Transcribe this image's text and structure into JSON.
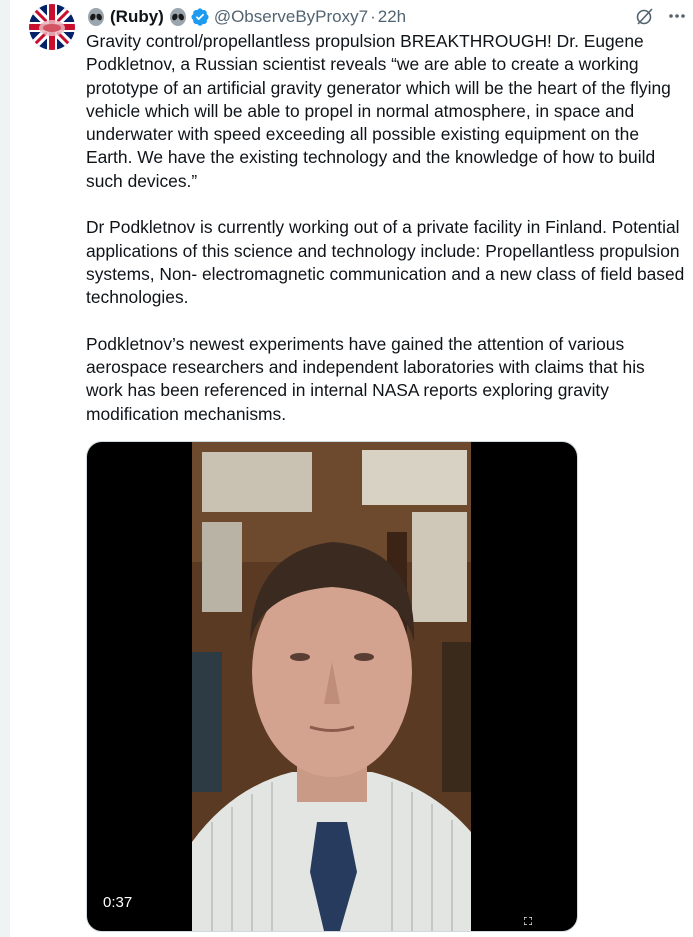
{
  "tweet": {
    "display_name": "(Ruby)",
    "handle": "@ObserveByProxy7",
    "separator": "·",
    "time": "22h",
    "paragraphs": [
      "Gravity control/propellantless propulsion BREAKTHROUGH! Dr. Eugene Podkletnov, a Russian scientist reveals “we are able to create a working prototype of an artificial gravity generator which will be the heart of the flying vehicle which will be able to propel in normal atmosphere, in space and underwater with speed exceeding all possible existing equipment on the Earth. We have the existing technology and the knowledge of how to build such devices.”",
      "Dr Podkletnov is currently working out of a private facility in Finland. Potential applications of this science and technology include: Propellantless propulsion systems, Non- electromagnetic communication and a new class of field based technologies.",
      "Podkletnov’s newest experiments have gained the attention of various aerospace researchers and independent laboratories with claims that his work has been referenced in internal NASA reports exploring gravity modification mechanisms."
    ],
    "video": {
      "duration": "0:37"
    }
  },
  "icons": {
    "name_prefix": "alien-icon",
    "name_suffix": "alien-icon",
    "verified": "verified-badge-icon",
    "grok": "grok-icon",
    "more": "more-icon",
    "fullscreen": "fullscreen-icon"
  },
  "colors": {
    "verified": "#1d9bf0",
    "secondary_text": "#536471",
    "primary_text": "#0f1419"
  }
}
